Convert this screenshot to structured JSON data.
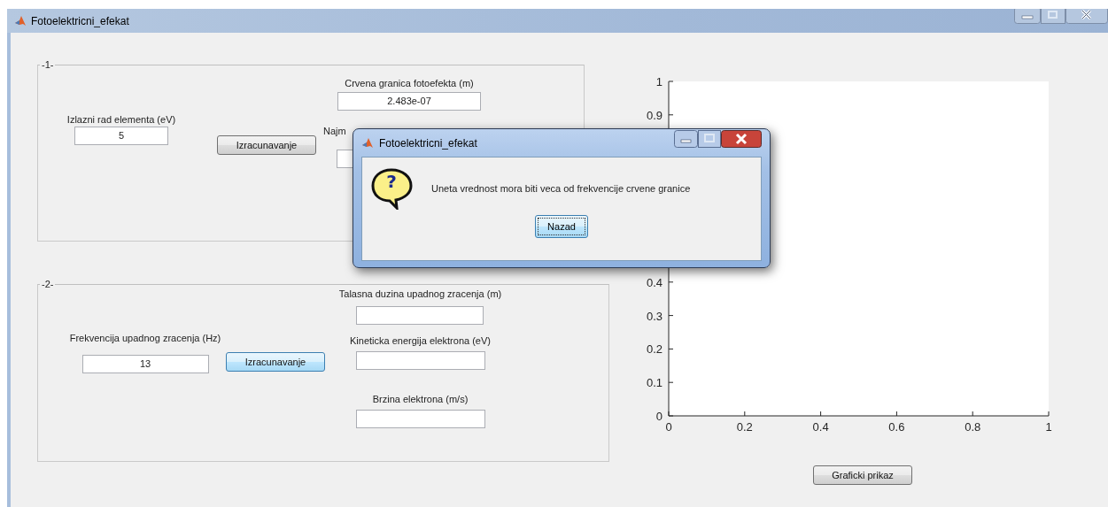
{
  "window": {
    "title": "Fotoelektricni_efekat"
  },
  "panel_1": {
    "title": "-1-",
    "input_label": "Izlazni rad elementa (eV)",
    "input_value": "5",
    "button": {
      "label": "Izracunavanje",
      "focused": false
    },
    "outputs": [
      {
        "label": "Crvena granica fotoefekta (m)",
        "value": "2.483e-07"
      },
      {
        "label": "Najm"
      }
    ]
  },
  "panel_2": {
    "title": "-2-",
    "input_label": "Frekvencija upadnog zracenja (Hz)",
    "input_value": "13",
    "button": {
      "label": "Izracunavanje",
      "focused": true
    },
    "outputs": [
      {
        "label": "Talasna duzina upadnog zracenja (m)"
      },
      {
        "label": "Kineticka energija elektrona (eV)"
      },
      {
        "label": "Brzina elektrona (m/s)"
      }
    ]
  },
  "plot": {
    "chart_data": {
      "type": "line",
      "xlim": [
        0,
        1
      ],
      "ylim": [
        0,
        1
      ],
      "xticks": [
        0,
        0.2,
        0.4,
        0.6,
        0.8,
        1
      ],
      "yticks": [
        0,
        0.1,
        0.2,
        0.3,
        0.4,
        0.9,
        1
      ]
    },
    "button": "Graficki prikaz"
  },
  "dialog": {
    "title": "Fotoelektricni_efekat",
    "icon": "?",
    "message": "Uneta vrednost mora biti veca od frekvencije crvene granice",
    "button": "Nazad"
  }
}
